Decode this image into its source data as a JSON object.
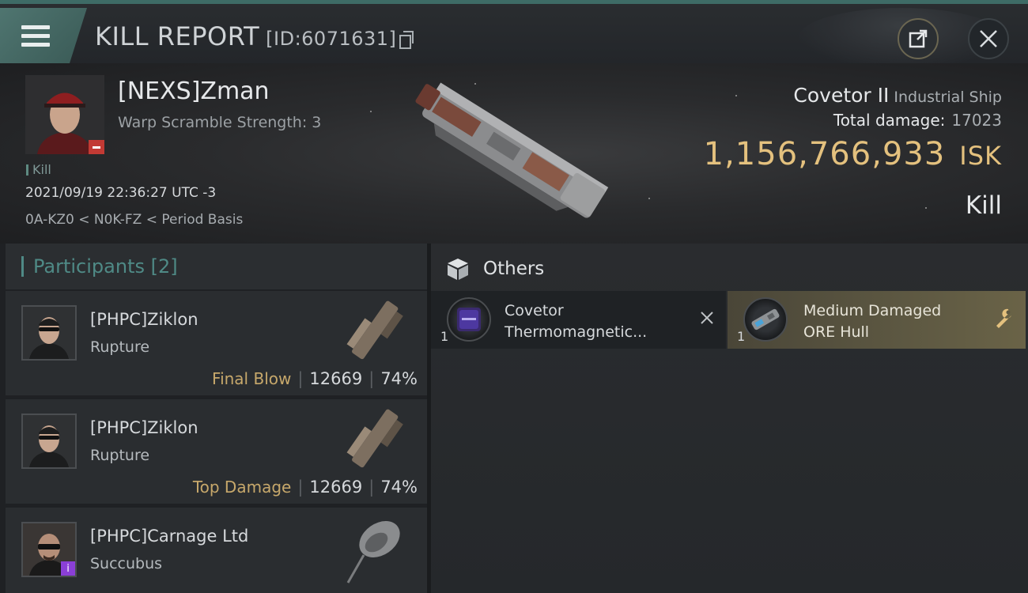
{
  "header": {
    "title": "KILL REPORT",
    "report_id": "[ID:6071631]"
  },
  "victim": {
    "name": "[NEXS]Zman",
    "warp_scramble": "Warp Scramble Strength: 3",
    "kill_label": "Kill",
    "datetime": "2021/09/19 22:36:27 UTC -3",
    "location": "0A-KZ0 < N0K-FZ < Period Basis",
    "ship_name": "Covetor II",
    "ship_class": "Industrial Ship",
    "total_damage_label": "Total damage:",
    "total_damage_value": "17023",
    "isk_value": "1,156,766,933",
    "isk_unit": "ISK",
    "result": "Kill"
  },
  "participants": {
    "header": "Participants [2]",
    "rows": [
      {
        "name": "[PHPC]Ziklon",
        "ship": "Rupture",
        "tag": "Final Blow",
        "damage": "12669",
        "percent": "74%"
      },
      {
        "name": "[PHPC]Ziklon",
        "ship": "Rupture",
        "tag": "Top Damage",
        "damage": "12669",
        "percent": "74%"
      },
      {
        "name": "[PHPC]Carnage Ltd",
        "ship": "Succubus",
        "tag": "",
        "damage": "",
        "percent": ""
      }
    ]
  },
  "others": {
    "header": "Others",
    "items": [
      {
        "qty": "1",
        "name_line1": "Covetor",
        "name_line2": "Thermomagnetic..."
      },
      {
        "qty": "1",
        "name_line1": "Medium Damaged",
        "name_line2": "ORE Hull"
      }
    ]
  },
  "colors": {
    "accent_teal": "#4f8a86",
    "isk_gold": "#e4c17e",
    "final_blow_gold": "#c7a86b",
    "badge_red": "#c23a34"
  }
}
